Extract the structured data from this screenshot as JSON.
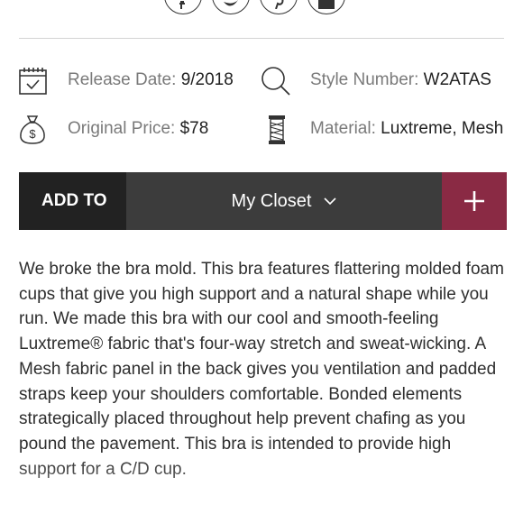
{
  "social": [
    "facebook-icon",
    "twitter-icon",
    "pinterest-icon",
    "email-icon"
  ],
  "details": {
    "release_label": "Release Date:",
    "release_value": "9/2018",
    "style_label": "Style Number:",
    "style_value": "W2ATAS",
    "price_label": "Original Price:",
    "price_value": "$78",
    "material_label": "Material:",
    "material_value": "Luxtreme, Mesh"
  },
  "actions": {
    "add_to_label": "ADD TO",
    "closet_label": "My Closet",
    "plus_label": "+"
  },
  "colors": {
    "dark_bar": "#222222",
    "closet_bar": "#3c3c3c",
    "accent": "#8a2a44"
  },
  "description": "We broke the bra mold. This bra features flattering molded foam cups that give you high support and a natural shape while you run. We made this bra with our cool and smooth-feeling Luxtreme® fabric that's four-way stretch and sweat-wicking. A Mesh fabric panel in the back gives you ventilation and padded straps keep your shoulders comfortable. Bonded elements strategically placed throughout help prevent chafing as you pound the pavement. This bra is intended to provide high support for a C/D cup."
}
